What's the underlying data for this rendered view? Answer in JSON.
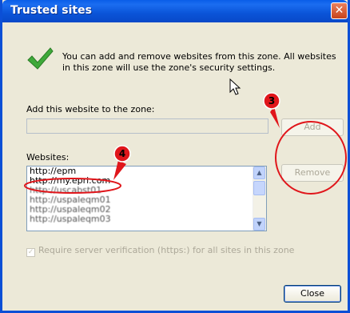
{
  "window": {
    "title": "Trusted sites",
    "close_glyph": "✕"
  },
  "intro_text": "You can add and remove websites from this zone. All websites in this zone will use the zone's security settings.",
  "add_section": {
    "label": "Add this website to the zone:",
    "input_value": "",
    "add_button": "Add"
  },
  "websites": {
    "label": "Websites:",
    "items": [
      "http://epm",
      "http://my.epri.com",
      "http://uscabst01",
      "http://uspaleqm01",
      "http://uspaleqm02",
      "http://uspaleqm03"
    ],
    "remove_button": "Remove"
  },
  "verify_checkbox": {
    "checked": true,
    "label": "Require server verification (https:) for all sites in this zone"
  },
  "close_button": "Close",
  "annotations": {
    "callout_3": "3",
    "callout_4": "4",
    "annotation_color": "#e0161b"
  },
  "colors": {
    "titlebar": "#0a54d8",
    "dialog_bg": "#ece9d8",
    "disabled_text": "#aca899"
  }
}
